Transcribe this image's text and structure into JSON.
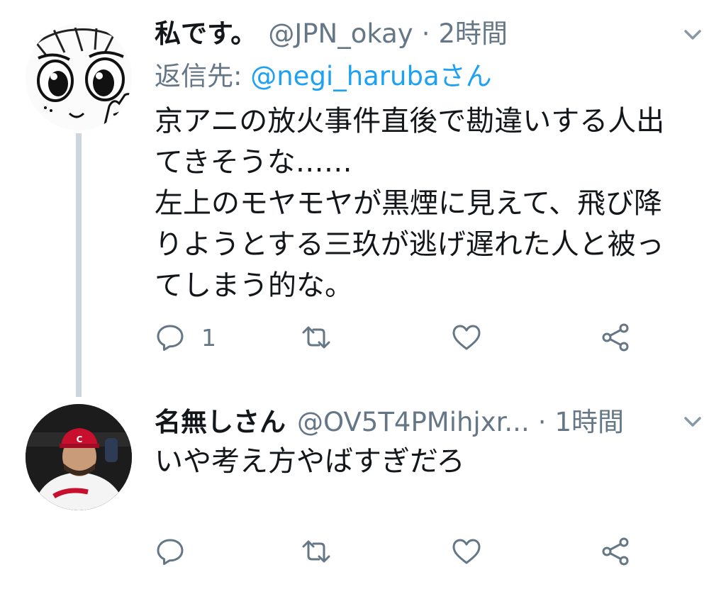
{
  "tweets": [
    {
      "display_name": "私です。",
      "handle": "@JPN_okay",
      "separator": "·",
      "time": "2時間",
      "reply_prefix": "返信先: ",
      "reply_mention": "@negi_harubaさん",
      "body_lines": [
        "京アニの放火事件直後で勘違いする人出",
        "てきそうな……",
        "左上のモヤモヤが黒煙に見えて、飛び降",
        "りようとする三玖が逃げ遅れた人と被っ",
        "てしまう的な。"
      ],
      "reply_count": "1",
      "avatar": "manga-face-avatar"
    },
    {
      "display_name": "名無しさん",
      "handle": "@OV5T4PMihjxr...",
      "separator": "·",
      "time": "1時間",
      "body_lines": [
        "いや考え方やばすぎだろ"
      ],
      "reply_count": "",
      "avatar": "baseball-player-avatar"
    }
  ],
  "icons": {
    "reply": "reply-icon",
    "retweet": "retweet-icon",
    "like": "heart-icon",
    "share": "share-icon",
    "more": "chevron-down-icon"
  },
  "colors": {
    "text": "#14171a",
    "secondary": "#657786",
    "link": "#1da1f2",
    "thread_line": "#ccd6dd",
    "cap_red": "#c8102e"
  }
}
